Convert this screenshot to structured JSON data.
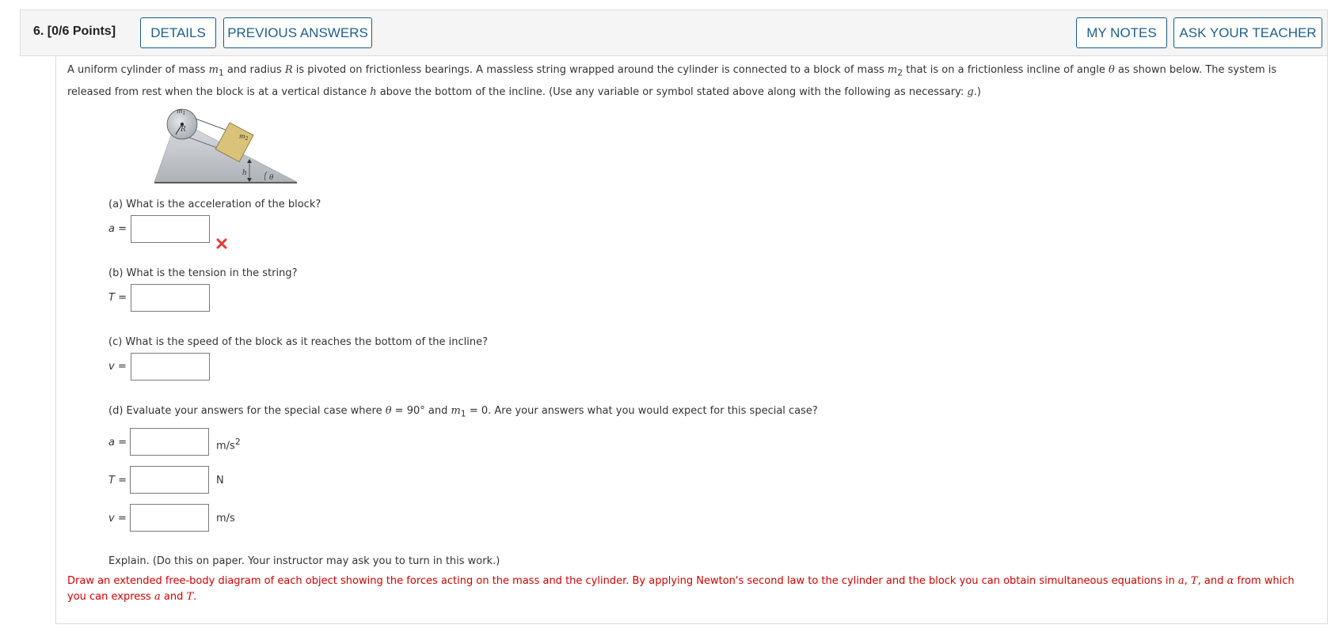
{
  "header": {
    "question_number": "6.",
    "points": "[0/6 Points]",
    "details_label": "DETAILS",
    "previous_answers_label": "PREVIOUS ANSWERS",
    "my_notes_label": "MY NOTES",
    "ask_teacher_label": "ASK YOUR TEACHER"
  },
  "problem": {
    "t1": "A uniform cylinder of mass ",
    "m": "m",
    "sub1": "1",
    "t2": " and radius ",
    "R": "R",
    "t3": " is pivoted on frictionless bearings. A massless string wrapped around the cylinder is connected to a block of mass ",
    "sub2": "2",
    "t4": " that is on a frictionless incline of angle ",
    "theta": "θ",
    "t5": " as shown below. The system is released from rest when the block is at a vertical distance ",
    "h": "h",
    "t6": " above the bottom of the incline. (Use any variable or symbol stated above along with the following as necessary: ",
    "g": "g",
    "t7": ".)"
  },
  "figure": {
    "m1": "m",
    "m1_sub": "1",
    "R": "R",
    "m2": "m",
    "m2_sub": "2",
    "h": "h",
    "theta": "θ",
    "colors": {
      "incline": "#c9ccd1",
      "block": "#d9c27a",
      "cylinder": "#b8bec6"
    }
  },
  "parts": {
    "a": {
      "question": "(a) What is the acceleration of the block?",
      "var": "a",
      "eq": " =",
      "status": "incorrect"
    },
    "b": {
      "question": "(b) What is the tension in the string?",
      "var": "T",
      "eq": " ="
    },
    "c": {
      "question": "(c) What is the speed of the block as it reaches the bottom of the incline?",
      "var": "v",
      "eq": " ="
    },
    "d": {
      "q1": "(d) Evaluate your answers for the special case where ",
      "theta": "θ",
      "q2": " = 90° and ",
      "m": "m",
      "sub": "1",
      "q3": " = 0. Are your answers what you would expect for this special case?",
      "rows": [
        {
          "var": "a",
          "eq": " =",
          "unit": "m/s",
          "unit_sup": "2"
        },
        {
          "var": "T",
          "eq": " =",
          "unit": "N",
          "unit_sup": ""
        },
        {
          "var": "v",
          "eq": " =",
          "unit": "m/s",
          "unit_sup": ""
        }
      ]
    }
  },
  "explain": "Explain. (Do this on paper. Your instructor may ask you to turn in this work.)",
  "hint": {
    "t1": "Draw an extended free-body diagram of each object showing the forces acting on the mass and the cylinder. By applying Newton's second law to the cylinder and the block you can obtain simultaneous equations in ",
    "a": "a",
    "c1": ", ",
    "T": "T",
    "c2": ", and ",
    "alpha": "α",
    "t2": " from which you can express ",
    "a2": "a",
    "and": " and ",
    "T2": "T",
    "end": "."
  },
  "colors": {
    "accent": "#1f5f8b",
    "error": "#d00000",
    "header_bg": "#f5f5f5"
  }
}
